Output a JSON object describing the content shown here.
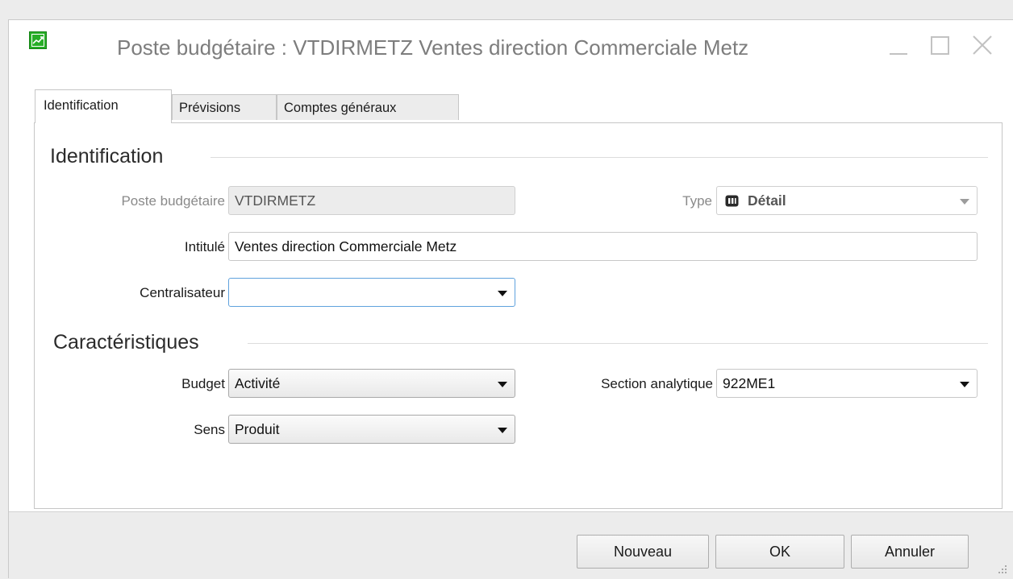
{
  "window": {
    "title": "Poste budgétaire : VTDIRMETZ Ventes direction Commerciale Metz",
    "icon": "budget-chart-icon"
  },
  "tabs": [
    {
      "label": "Identification",
      "active": true
    },
    {
      "label": "Prévisions",
      "active": false
    },
    {
      "label": "Comptes généraux",
      "active": false
    }
  ],
  "identification": {
    "section_title": "Identification",
    "poste": {
      "label": "Poste budgétaire",
      "value": "VTDIRMETZ"
    },
    "type": {
      "label": "Type",
      "value": "Détail",
      "icon": "detail-type-icon"
    },
    "intitule": {
      "label": "Intitulé",
      "value": "Ventes direction Commerciale Metz"
    },
    "centralisateur": {
      "label": "Centralisateur",
      "value": ""
    }
  },
  "caracteristiques": {
    "section_title": "Caractéristiques",
    "budget": {
      "label": "Budget",
      "value": "Activité"
    },
    "sens": {
      "label": "Sens",
      "value": "Produit"
    },
    "section_analytique": {
      "label": "Section analytique",
      "value": "922ME1"
    }
  },
  "buttons": {
    "nouveau": "Nouveau",
    "ok": "OK",
    "annuler": "Annuler"
  },
  "colors": {
    "accent_focus": "#5fa2dd",
    "app_icon_green": "#27ae27"
  }
}
